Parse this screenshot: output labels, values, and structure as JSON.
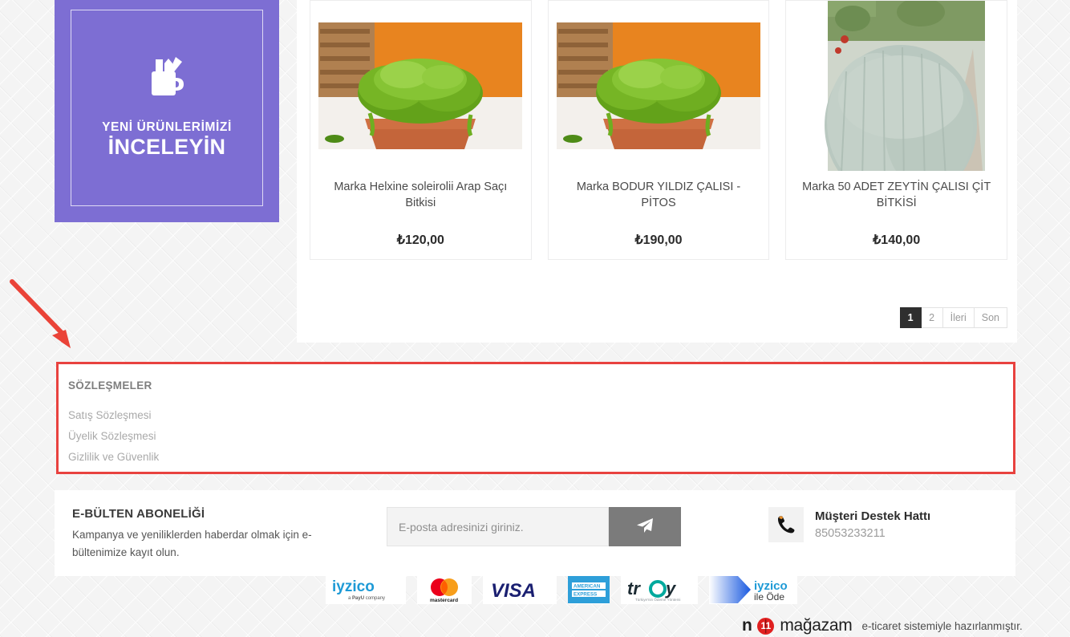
{
  "promo_banner": {
    "icon": "pen-holder-icon",
    "line1": "YENİ ÜRÜNLERİMİZİ",
    "line2": "İNCELEYİN",
    "background_color": "#7d6ed3"
  },
  "products": [
    {
      "name": "Marka Helxine soleirolii Arap Saçı Bitkisi",
      "price": "₺120,00",
      "image": "potted-green-plant"
    },
    {
      "name": "Marka BODUR YILDIZ ÇALISI - PİTOS",
      "price": "₺190,00",
      "image": "potted-green-plant"
    },
    {
      "name": "Marka 50 ADET ZEYTİN ÇALISI ÇİT BİTKİSİ",
      "price": "₺140,00",
      "image": "silver-olive-hedge"
    }
  ],
  "pagination": [
    {
      "label": "1",
      "active": true
    },
    {
      "label": "2",
      "active": false
    },
    {
      "label": "İleri",
      "active": false
    },
    {
      "label": "Son",
      "active": false
    }
  ],
  "contracts": {
    "title": "SÖZLEŞMELER",
    "highlight_color": "#e8423f",
    "links": [
      "Satış Sözleşmesi",
      "Üyelik Sözleşmesi",
      "Gizlilik ve Güvenlik"
    ]
  },
  "newsletter": {
    "title": "E-BÜLTEN ABONELİĞİ",
    "description": "Kampanya ve yeniliklerden haberdar olmak için e-bültenimize kayıt olun.",
    "placeholder": "E-posta adresinizi giriniz.",
    "value": "",
    "submit_icon": "paper-plane-icon"
  },
  "support": {
    "icon": "phone-icon",
    "title": "Müşteri Destek Hattı",
    "phone": "85053233211"
  },
  "payments": [
    {
      "name": "iyzico",
      "sub": "a PayU company"
    },
    {
      "name": "mastercard",
      "sub": "mastercard"
    },
    {
      "name": "VISA",
      "sub": ""
    },
    {
      "name": "AMERICAN EXPRESS",
      "sub": ""
    },
    {
      "name": "troy",
      "sub": ""
    },
    {
      "name": "iyzico ile Öde",
      "sub": "ile Öde"
    }
  ],
  "branding": {
    "n": "n",
    "bug": "11",
    "word": "mağazam",
    "tagline": "e-ticaret sistemiyle hazırlanmıştır."
  },
  "annotation": {
    "arrow_color": "#e8423f",
    "points_to": "contracts-box"
  }
}
